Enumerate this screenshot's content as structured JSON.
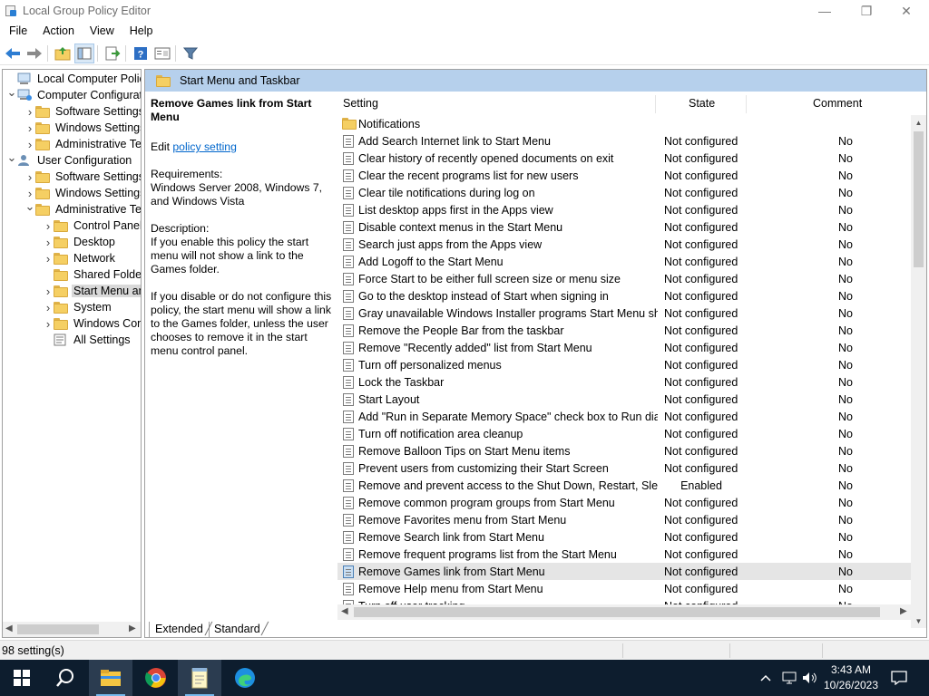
{
  "window": {
    "title": "Local Group Policy Editor",
    "minimize": "—",
    "maximize": "❐",
    "close": "✕"
  },
  "menu": [
    "File",
    "Action",
    "View",
    "Help"
  ],
  "tree": {
    "items": [
      {
        "label": "Local Computer Policy",
        "icon": "computer-icon",
        "level": 0,
        "toggle": ""
      },
      {
        "label": "Computer Configuration",
        "icon": "computer-config-icon",
        "level": 0,
        "toggle": "expanded"
      },
      {
        "label": "Software Settings",
        "icon": "folder-icon",
        "level": 1,
        "toggle": "collapsed"
      },
      {
        "label": "Windows Settings",
        "icon": "folder-icon",
        "level": 1,
        "toggle": "collapsed"
      },
      {
        "label": "Administrative Templates",
        "icon": "folder-icon",
        "level": 1,
        "toggle": "collapsed"
      },
      {
        "label": "User Configuration",
        "icon": "user-config-icon",
        "level": 0,
        "toggle": "expanded"
      },
      {
        "label": "Software Settings",
        "icon": "folder-icon",
        "level": 1,
        "toggle": "collapsed"
      },
      {
        "label": "Windows Settings",
        "icon": "folder-icon",
        "level": 1,
        "toggle": "collapsed"
      },
      {
        "label": "Administrative Templates",
        "icon": "folder-icon",
        "level": 1,
        "toggle": "expanded"
      },
      {
        "label": "Control Panel",
        "icon": "folder-icon",
        "level": 2,
        "toggle": "collapsed"
      },
      {
        "label": "Desktop",
        "icon": "folder-icon",
        "level": 2,
        "toggle": "collapsed"
      },
      {
        "label": "Network",
        "icon": "folder-icon",
        "level": 2,
        "toggle": "collapsed"
      },
      {
        "label": "Shared Folders",
        "icon": "folder-icon",
        "level": 2,
        "toggle": ""
      },
      {
        "label": "Start Menu and Taskbar",
        "icon": "folder-icon",
        "level": 2,
        "toggle": "collapsed",
        "selected": true
      },
      {
        "label": "System",
        "icon": "folder-icon",
        "level": 2,
        "toggle": "collapsed"
      },
      {
        "label": "Windows Components",
        "icon": "folder-icon",
        "level": 2,
        "toggle": "collapsed"
      },
      {
        "label": "All Settings",
        "icon": "all-settings-icon",
        "level": 2,
        "toggle": ""
      }
    ]
  },
  "node_header": "Start Menu and Taskbar",
  "description": {
    "title": "Remove Games link from Start Menu",
    "edit_prefix": "Edit",
    "edit_link": "policy setting",
    "requirements_label": "Requirements:",
    "requirements": "Windows Server 2008, Windows 7, and Windows Vista",
    "description_label": "Description:",
    "para1": "If you enable this policy the start menu will not show a link to the Games folder.",
    "para2": "If you disable or do not configure this policy, the start menu will show a link to the Games folder, unless the user chooses to remove it in the start menu control panel."
  },
  "columns": {
    "setting": "Setting",
    "state": "State",
    "comment": "Comment"
  },
  "rows": [
    {
      "name": "Notifications",
      "state": "",
      "comment": "",
      "type": "folder"
    },
    {
      "name": "Add Search Internet link to Start Menu",
      "state": "Not configured",
      "comment": "No"
    },
    {
      "name": "Clear history of recently opened documents on exit",
      "state": "Not configured",
      "comment": "No"
    },
    {
      "name": "Clear the recent programs list for new users",
      "state": "Not configured",
      "comment": "No"
    },
    {
      "name": "Clear tile notifications during log on",
      "state": "Not configured",
      "comment": "No"
    },
    {
      "name": "List desktop apps first in the Apps view",
      "state": "Not configured",
      "comment": "No"
    },
    {
      "name": "Disable context menus in the Start Menu",
      "state": "Not configured",
      "comment": "No"
    },
    {
      "name": "Search just apps from the Apps view",
      "state": "Not configured",
      "comment": "No"
    },
    {
      "name": "Add Logoff to the Start Menu",
      "state": "Not configured",
      "comment": "No"
    },
    {
      "name": "Force Start to be either full screen size or menu size",
      "state": "Not configured",
      "comment": "No"
    },
    {
      "name": "Go to the desktop instead of Start when signing in",
      "state": "Not configured",
      "comment": "No"
    },
    {
      "name": "Gray unavailable Windows Installer programs Start Menu sh...",
      "state": "Not configured",
      "comment": "No"
    },
    {
      "name": "Remove the People Bar from the taskbar",
      "state": "Not configured",
      "comment": "No"
    },
    {
      "name": "Remove \"Recently added\" list from Start Menu",
      "state": "Not configured",
      "comment": "No"
    },
    {
      "name": "Turn off personalized menus",
      "state": "Not configured",
      "comment": "No"
    },
    {
      "name": "Lock the Taskbar",
      "state": "Not configured",
      "comment": "No"
    },
    {
      "name": "Start Layout",
      "state": "Not configured",
      "comment": "No"
    },
    {
      "name": "Add \"Run in Separate Memory Space\" check box to Run dial...",
      "state": "Not configured",
      "comment": "No"
    },
    {
      "name": "Turn off notification area cleanup",
      "state": "Not configured",
      "comment": "No"
    },
    {
      "name": "Remove Balloon Tips on Start Menu items",
      "state": "Not configured",
      "comment": "No"
    },
    {
      "name": "Prevent users from customizing their Start Screen",
      "state": "Not configured",
      "comment": "No"
    },
    {
      "name": "Remove and prevent access to the Shut Down, Restart, Sleep...",
      "state": "Enabled",
      "comment": "No"
    },
    {
      "name": "Remove common program groups from Start Menu",
      "state": "Not configured",
      "comment": "No"
    },
    {
      "name": "Remove Favorites menu from Start Menu",
      "state": "Not configured",
      "comment": "No"
    },
    {
      "name": "Remove Search link from Start Menu",
      "state": "Not configured",
      "comment": "No"
    },
    {
      "name": "Remove frequent programs list from the Start Menu",
      "state": "Not configured",
      "comment": "No"
    },
    {
      "name": "Remove Games link from Start Menu",
      "state": "Not configured",
      "comment": "No",
      "selected": true
    },
    {
      "name": "Remove Help menu from Start Menu",
      "state": "Not configured",
      "comment": "No"
    },
    {
      "name": "Turn off user tracking",
      "state": "Not configured",
      "comment": "No"
    }
  ],
  "tabs": {
    "extended": "Extended",
    "standard": "Standard"
  },
  "status": "98 setting(s)",
  "taskbar": {
    "apps": [
      "start-icon",
      "search-icon",
      "file-explorer-icon",
      "chrome-icon",
      "notepad-icon",
      "edge-icon"
    ],
    "time": "3:43 AM",
    "date": "10/26/2023"
  },
  "colors": {
    "header_bg": "#b6d0ec",
    "taskbar_bg": "#0d1d2e",
    "link": "#0066cc"
  }
}
